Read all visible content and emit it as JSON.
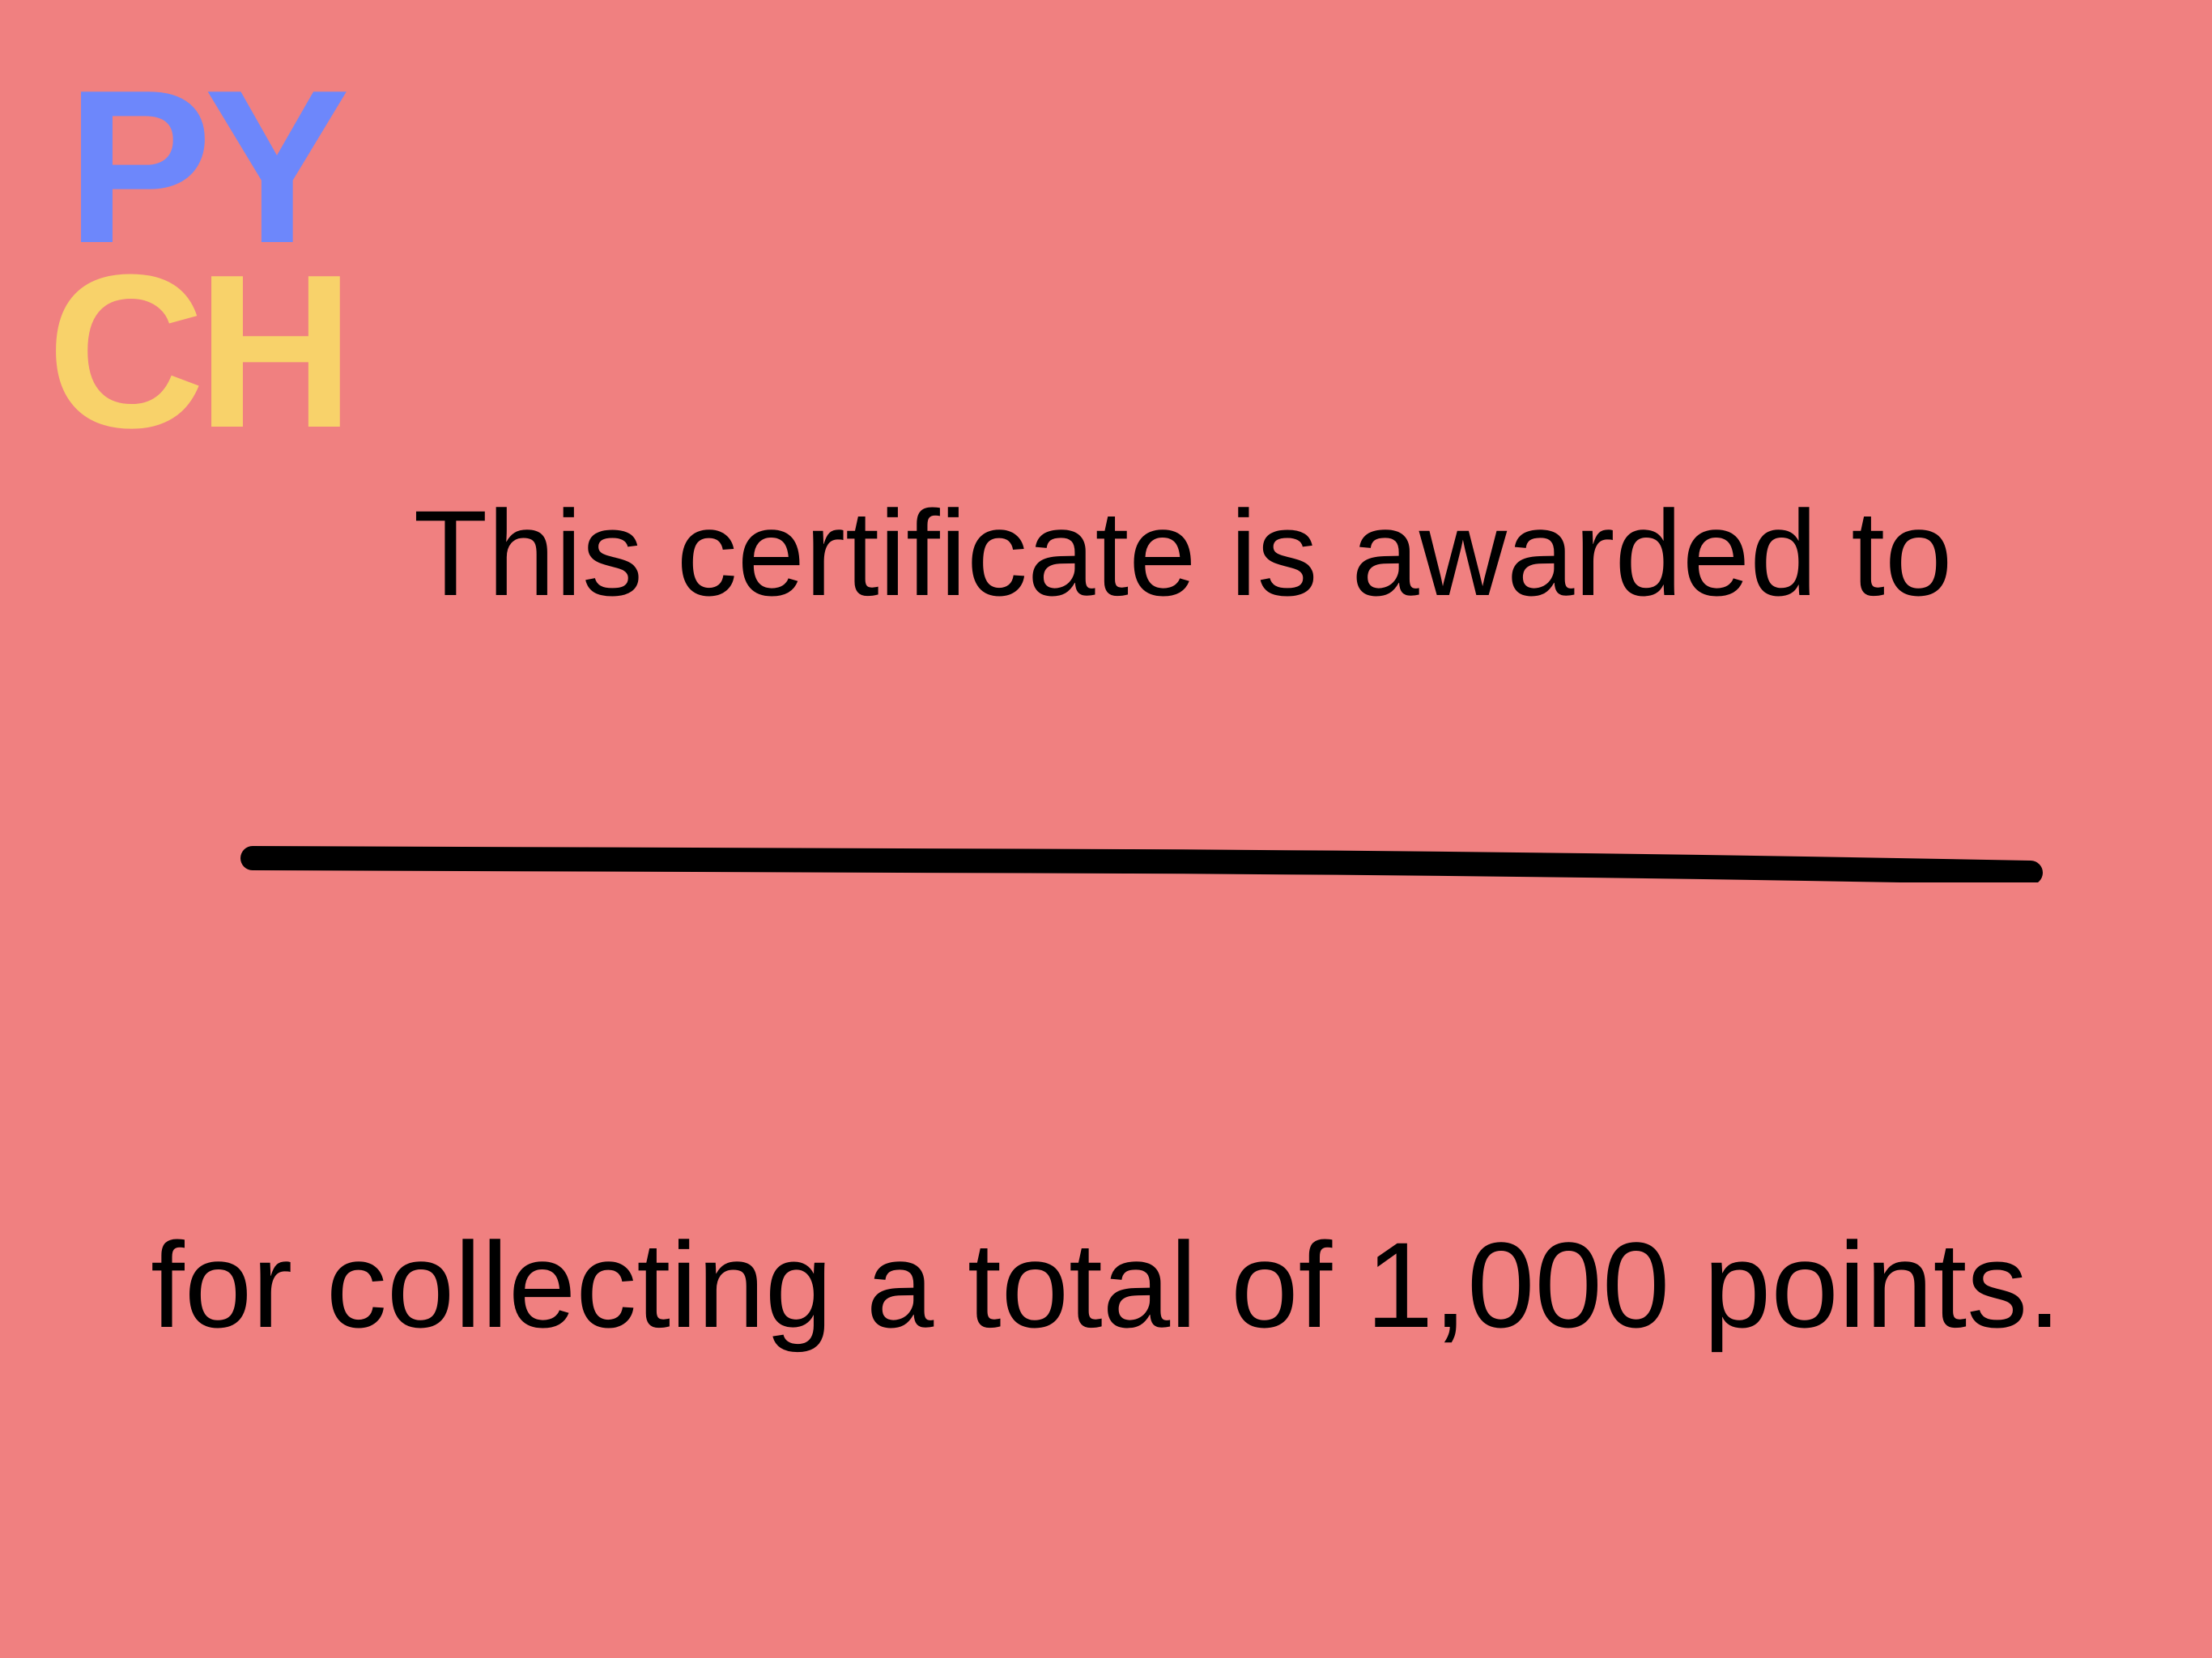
{
  "logo": {
    "line1": "PY",
    "line2": "CH"
  },
  "certificate": {
    "awarded_text": "This certificate is awarded to",
    "recipient_name": "",
    "achievement_text": "for collecting a total of 1,000 points."
  },
  "colors": {
    "background": "#f08080",
    "logo_py": "#6d87fb",
    "logo_ch": "#f8d26a",
    "text": "#000000",
    "line": "#000000"
  }
}
